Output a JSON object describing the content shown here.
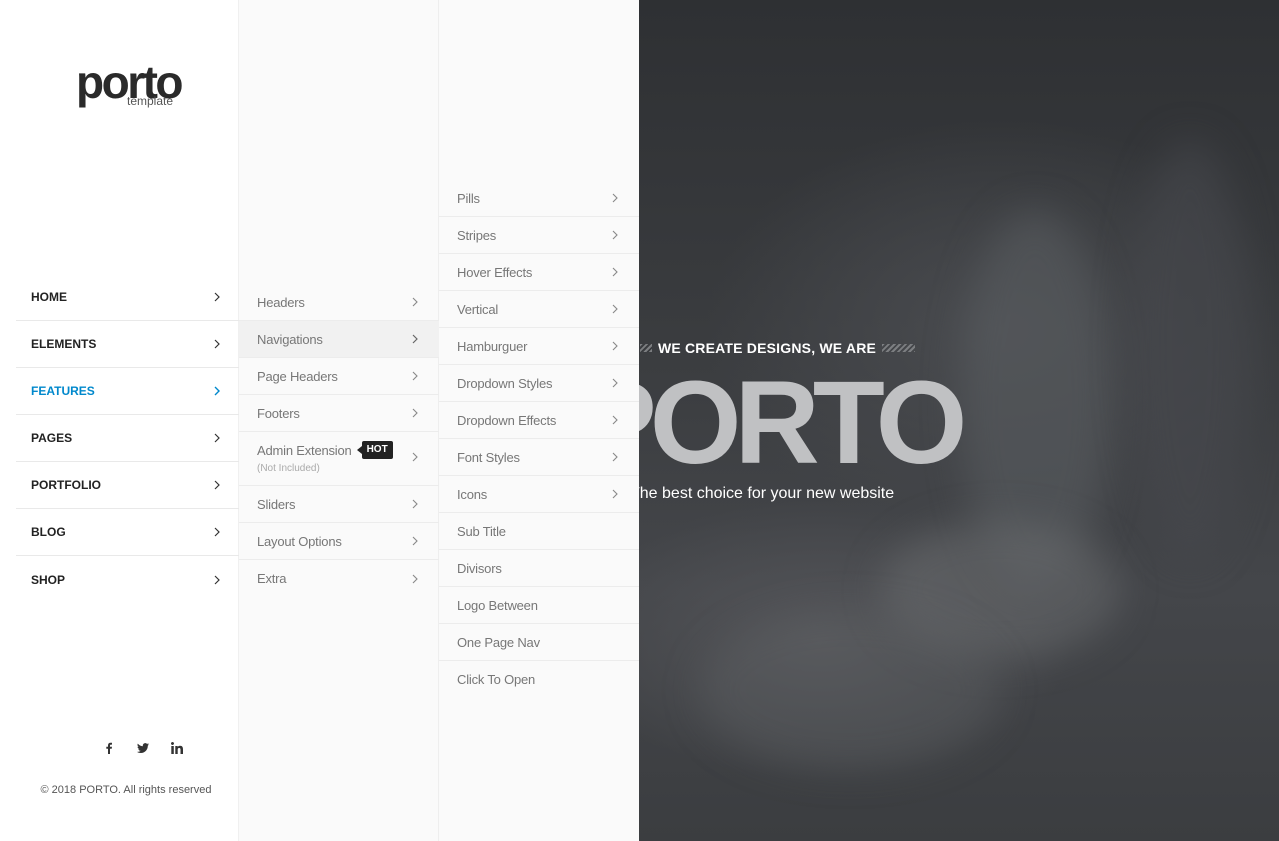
{
  "logo": {
    "main": "porto",
    "sub": "template"
  },
  "main_menu": [
    {
      "label": "HOME"
    },
    {
      "label": "ELEMENTS"
    },
    {
      "label": "FEATURES"
    },
    {
      "label": "PAGES"
    },
    {
      "label": "PORTFOLIO"
    },
    {
      "label": "BLOG"
    },
    {
      "label": "SHOP"
    }
  ],
  "features_menu": [
    {
      "label": "Headers"
    },
    {
      "label": "Navigations"
    },
    {
      "label": "Page Headers"
    },
    {
      "label": "Footers"
    },
    {
      "label": "Admin Extension",
      "badge": "HOT",
      "note": "(Not Included)"
    },
    {
      "label": "Sliders"
    },
    {
      "label": "Layout Options"
    },
    {
      "label": "Extra"
    }
  ],
  "navigations_menu": [
    {
      "label": "Pills"
    },
    {
      "label": "Stripes"
    },
    {
      "label": "Hover Effects"
    },
    {
      "label": "Vertical"
    },
    {
      "label": "Hamburguer"
    },
    {
      "label": "Dropdown Styles"
    },
    {
      "label": "Dropdown Effects"
    },
    {
      "label": "Font Styles"
    },
    {
      "label": "Icons"
    },
    {
      "label": "Sub Title"
    },
    {
      "label": "Divisors"
    },
    {
      "label": "Logo Between"
    },
    {
      "label": "One Page Nav"
    },
    {
      "label": "Click To Open"
    }
  ],
  "social": [
    "facebook-icon",
    "twitter-icon",
    "linkedin-icon"
  ],
  "copyright": "© 2018 PORTO. All rights reserved",
  "hero": {
    "kicker": "WE CREATE DESIGNS, WE ARE",
    "title": "PORTO",
    "subtitle": "The best choice for your new website"
  },
  "colors": {
    "accent": "#0088cc",
    "menu_text": "#222222",
    "submenu_text": "#777777"
  }
}
